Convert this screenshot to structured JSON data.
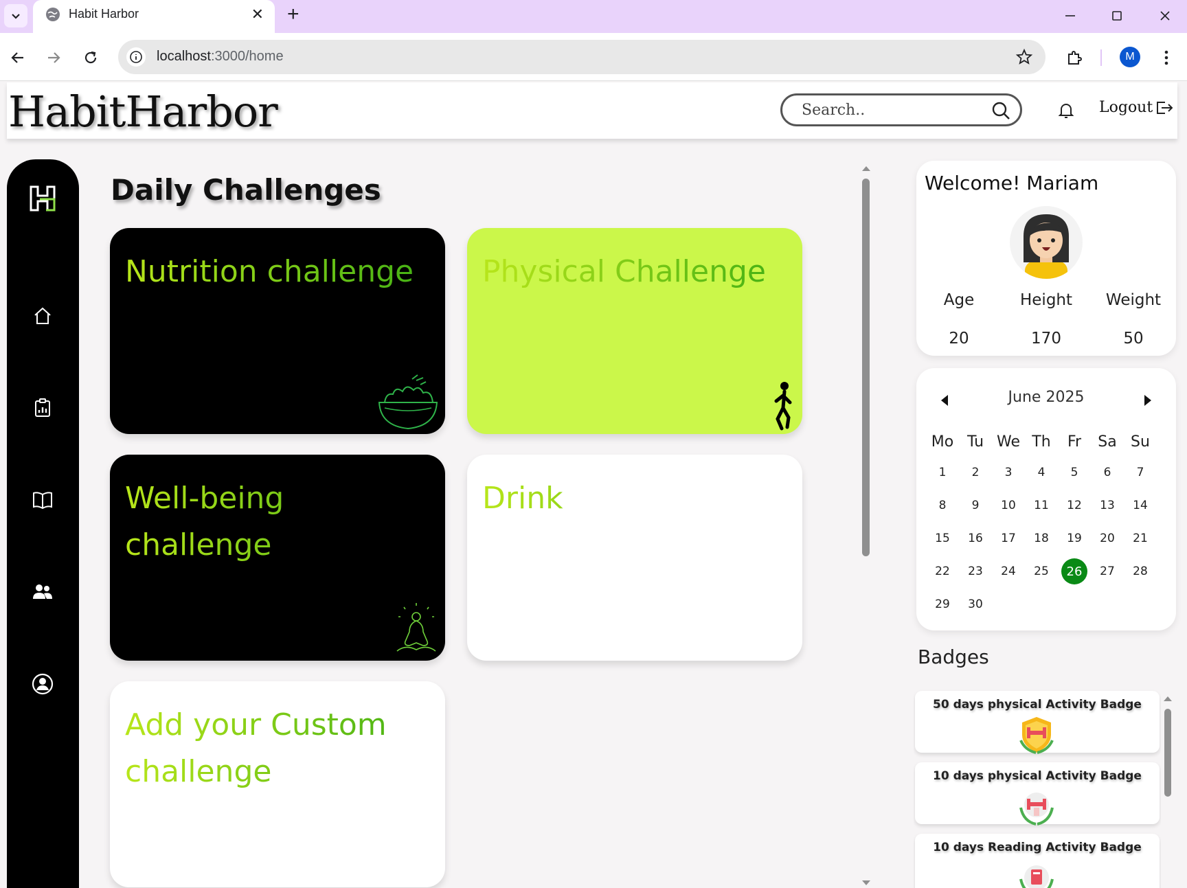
{
  "browser": {
    "tab_title": "Habit Harbor",
    "url_host": "localhost",
    "url_path": ":3000/home",
    "profile_initial": "M"
  },
  "header": {
    "logo": "HabitHarbor",
    "search_placeholder": "Search..",
    "logout_label": "Logout"
  },
  "sidebar": {
    "items": [
      {
        "icon": "home-icon"
      },
      {
        "icon": "report-icon"
      },
      {
        "icon": "book-icon"
      },
      {
        "icon": "users-icon"
      },
      {
        "icon": "profile-icon"
      }
    ]
  },
  "main": {
    "title": "Daily Challenges",
    "cards": [
      {
        "title": "Nutrition challenge",
        "style": "black",
        "icon": "salad-bowl-icon"
      },
      {
        "title": "Physical Challenge",
        "style": "lime",
        "icon": "walking-person-icon"
      },
      {
        "title": "Well-being challenge",
        "style": "black",
        "icon": "meditation-icon"
      },
      {
        "title": "Drink",
        "style": "white",
        "icon": ""
      },
      {
        "title": "Add your Custom challenge",
        "style": "white",
        "icon": ""
      }
    ]
  },
  "profile": {
    "welcome": "Welcome! Mariam",
    "stats": [
      {
        "label": "Age",
        "value": "20"
      },
      {
        "label": "Height",
        "value": "170"
      },
      {
        "label": "Weight",
        "value": "50"
      }
    ]
  },
  "calendar": {
    "month": "June 2025",
    "weekdays": [
      "Mo",
      "Tu",
      "We",
      "Th",
      "Fr",
      "Sa",
      "Su"
    ],
    "days": [
      "1",
      "2",
      "3",
      "4",
      "5",
      "6",
      "7",
      "8",
      "9",
      "10",
      "11",
      "12",
      "13",
      "14",
      "15",
      "16",
      "17",
      "18",
      "19",
      "20",
      "21",
      "22",
      "23",
      "24",
      "25",
      "26",
      "27",
      "28",
      "29",
      "30"
    ],
    "selected": "26",
    "accent": "#0a8a16"
  },
  "badges": {
    "title": "Badges",
    "items": [
      {
        "label": "50 days physical Activity Badge",
        "icon": "gold-dumbbell-badge-icon"
      },
      {
        "label": "10 days physical Activity Badge",
        "icon": "silver-dumbbell-badge-icon"
      },
      {
        "label": "10 days Reading Activity Badge",
        "icon": "book-badge-icon"
      }
    ]
  },
  "colors": {
    "brand_lime": "#cbf74a",
    "gradient_start": "#b8e61a",
    "gradient_end": "#3fae14",
    "tab_bar": "#e9d3fb"
  }
}
